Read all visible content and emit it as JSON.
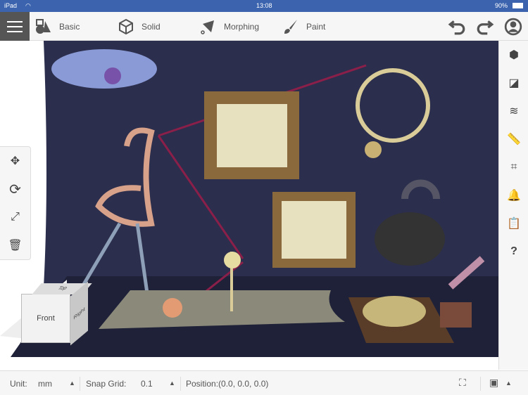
{
  "status": {
    "device": "iPad",
    "time": "13:08",
    "battery": "90%"
  },
  "toolbar": {
    "basic": "Basic",
    "solid": "Solid",
    "morphing": "Morphing",
    "paint": "Paint"
  },
  "viewcube": {
    "front": "Front",
    "top": "Top",
    "right": "Right"
  },
  "bottom": {
    "unit_label": "Unit:",
    "unit_value": "mm",
    "snap_label": "Snap Grid:",
    "snap_value": "0.1",
    "position": "Position:(0.0, 0.0, 0.0)"
  },
  "colors": {
    "status": "#3b63ae",
    "backdrop": "#2b2e4c",
    "menu": "#555555"
  }
}
